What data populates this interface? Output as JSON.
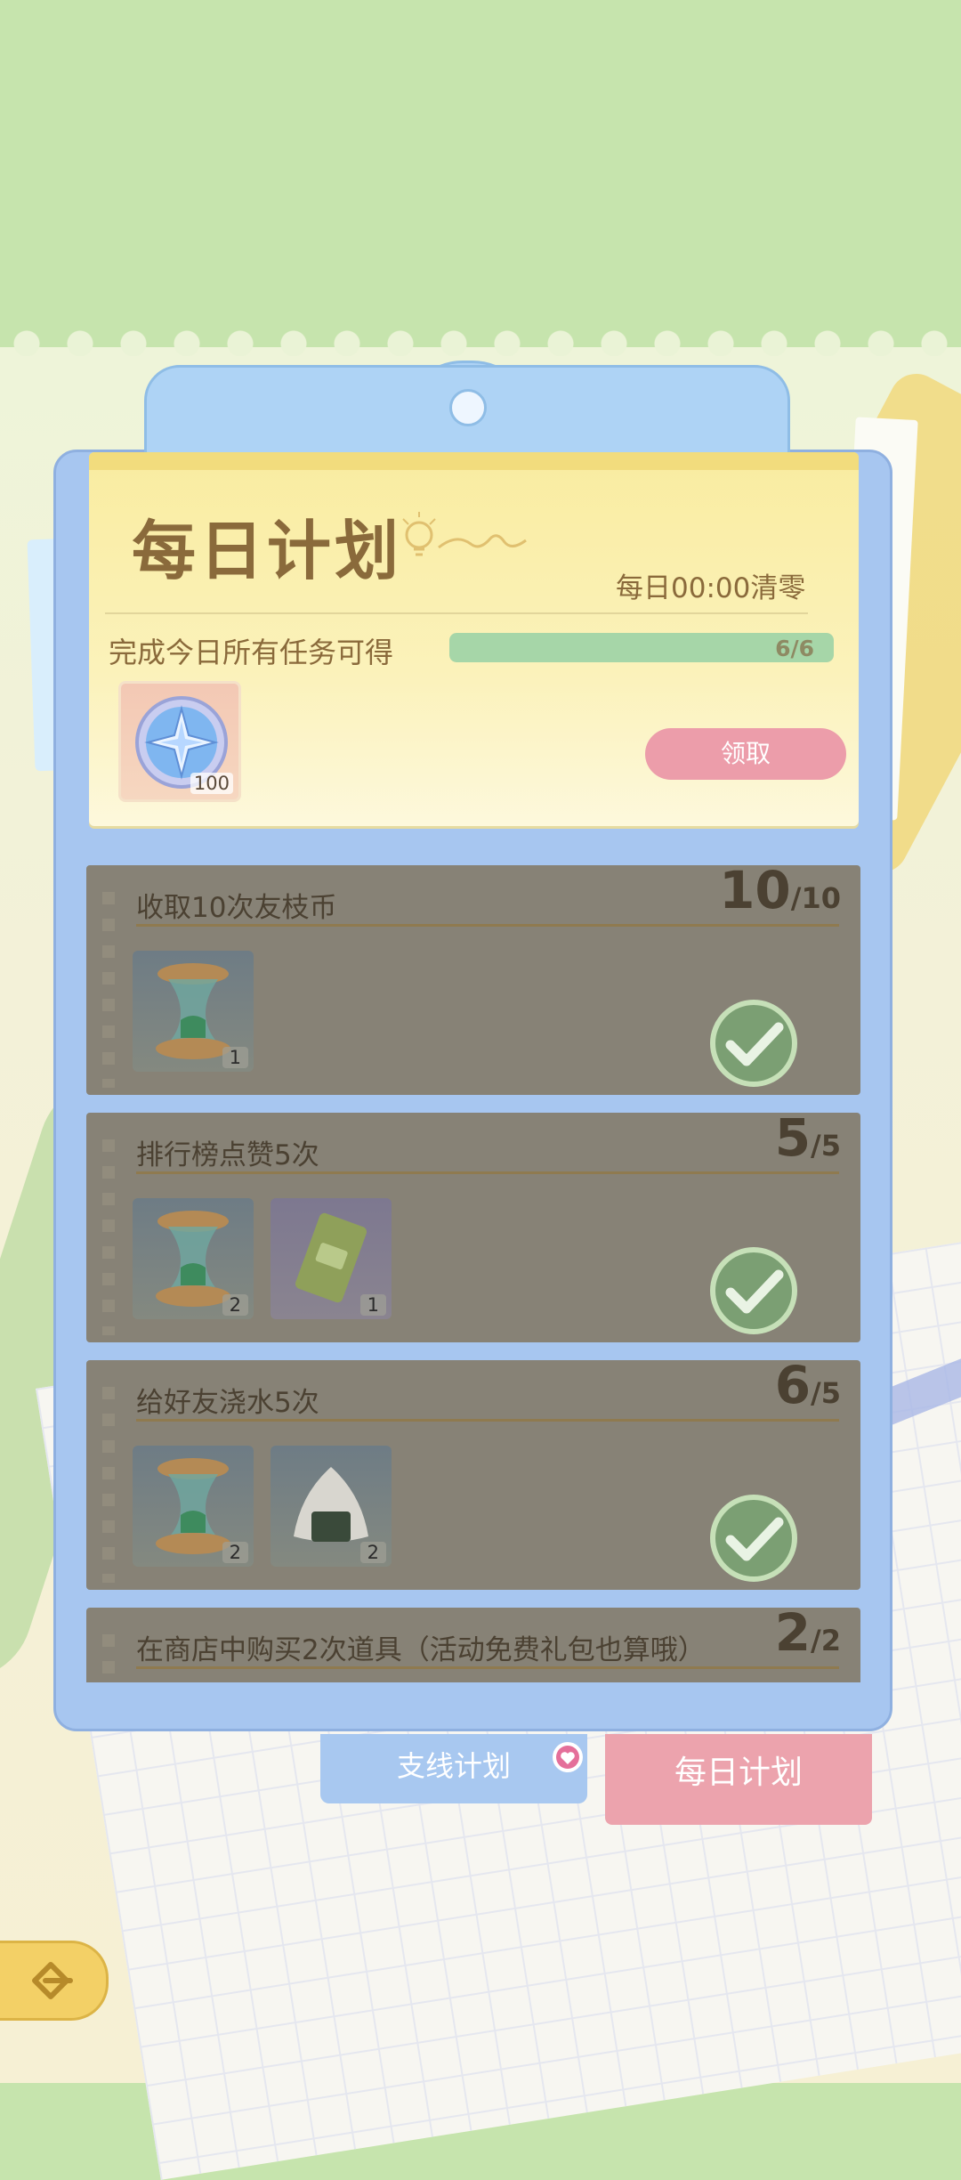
{
  "header": {
    "title": "每日计划",
    "reset_text": "每日00:00清零",
    "reward_label": "完成今日所有任务可得",
    "progress_text": "6/6",
    "progress_fraction": 1.0,
    "reward_item": {
      "icon": "compass-star-icon",
      "count": "100"
    },
    "claim_label": "领取"
  },
  "tasks": [
    {
      "name": "收取10次友枝币",
      "count": "10",
      "total": "/10",
      "rewards": [
        {
          "icon": "hourglass-icon",
          "qty": "1"
        }
      ],
      "completed": true
    },
    {
      "name": "排行榜点赞5次",
      "count": "5",
      "total": "/5",
      "rewards": [
        {
          "icon": "hourglass-icon",
          "qty": "2"
        },
        {
          "icon": "ticket-icon",
          "qty": "1"
        }
      ],
      "completed": true
    },
    {
      "name": "给好友浇水5次",
      "count": "6",
      "total": "/5",
      "rewards": [
        {
          "icon": "hourglass-icon",
          "qty": "2"
        },
        {
          "icon": "rice-ball-icon",
          "qty": "2"
        }
      ],
      "completed": true
    },
    {
      "name": "在商店中购买2次道具（活动免费礼包也算哦）",
      "count": "2",
      "total": "/2",
      "rewards": [],
      "completed": true
    }
  ],
  "tabs": {
    "side_plan": "支线计划",
    "daily_plan": "每日计划"
  },
  "colors": {
    "claim": "#ec9daa",
    "board": "#a7c6f0",
    "progress": "#a6d6a8",
    "tab_active": "#eca3ad"
  }
}
